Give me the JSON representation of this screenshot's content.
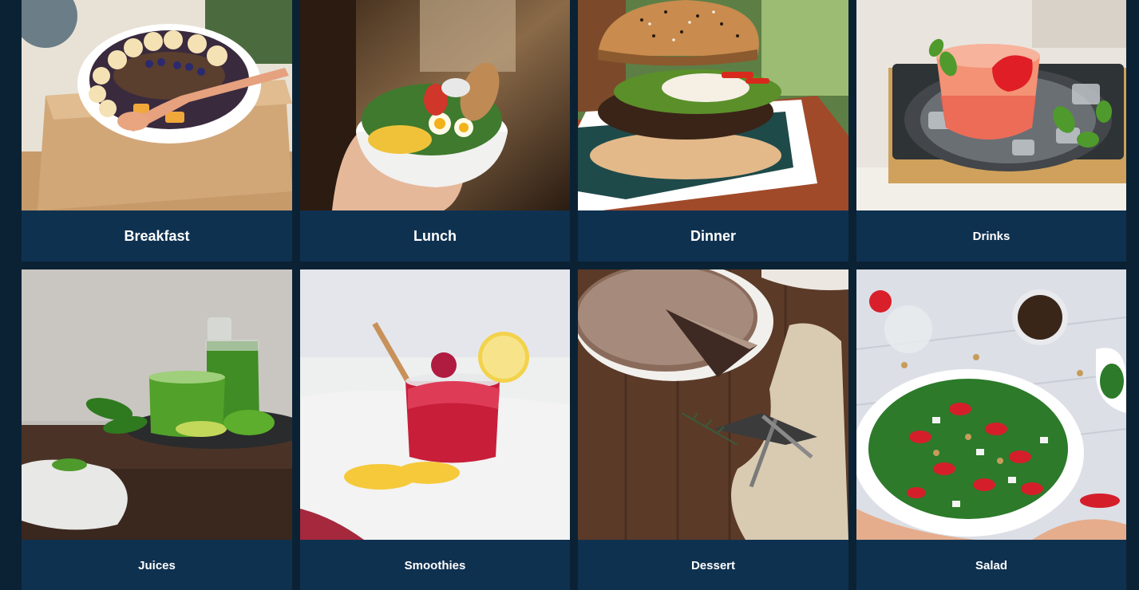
{
  "categories": [
    {
      "label": "Breakfast",
      "image": "acai-bowl-photo",
      "bg": "#d9cbb5"
    },
    {
      "label": "Lunch",
      "image": "salad-bowl-photo",
      "bg": "#6b4a2f"
    },
    {
      "label": "Dinner",
      "image": "burger-photo",
      "bg": "#4a6b3a"
    },
    {
      "label": "Drinks",
      "image": "strawberry-cocktail-photo",
      "bg": "#e8e4df"
    },
    {
      "label": "Juices",
      "image": "green-juice-photo",
      "bg": "#bdbab5"
    },
    {
      "label": "Smoothies",
      "image": "berry-smoothie-photo",
      "bg": "#e6e7ea"
    },
    {
      "label": "Dessert",
      "image": "cake-photo",
      "bg": "#5a3a26"
    },
    {
      "label": "Salad",
      "image": "strawberry-spinach-salad-photo",
      "bg": "#dfe3ea"
    }
  ],
  "colors": {
    "page_background": "#0b2234",
    "card_label_background": "#0f3150",
    "label_text": "#ffffff"
  }
}
